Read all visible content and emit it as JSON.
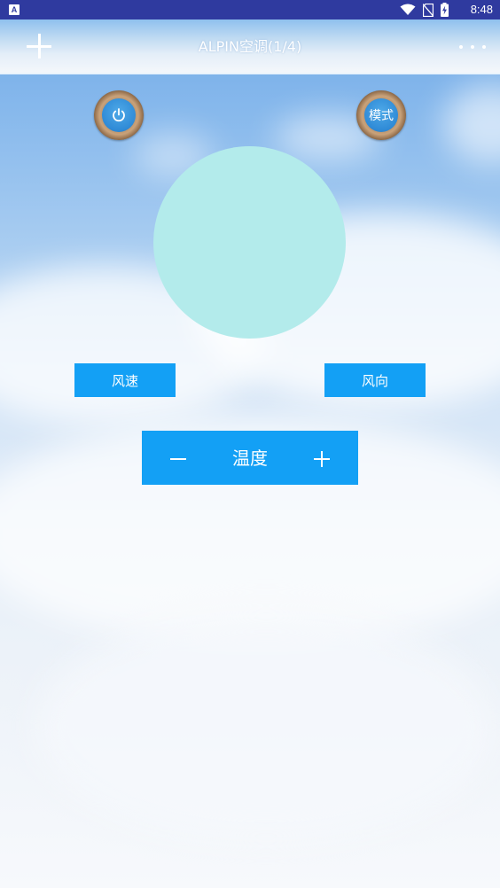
{
  "status_bar": {
    "notification_glyph": "A",
    "time": "8:48",
    "icons": [
      "notification-icon",
      "wifi-icon",
      "no-sim-icon",
      "battery-charging-icon"
    ]
  },
  "header": {
    "title": "ALPIN空调(1/4)",
    "icons": [
      "add-icon",
      "more-icon"
    ]
  },
  "controls": {
    "power_icon": "power-icon",
    "mode_label": "模式",
    "fan_speed_label": "风速",
    "fan_direction_label": "风向",
    "temperature_label": "温度",
    "temp_decrease_icon": "minus-icon",
    "temp_increase_icon": "plus-icon"
  },
  "colors": {
    "status_bar": "#2f3a9f",
    "button_blue": "#13a0f5",
    "display_circle": "#b3ebeb"
  }
}
